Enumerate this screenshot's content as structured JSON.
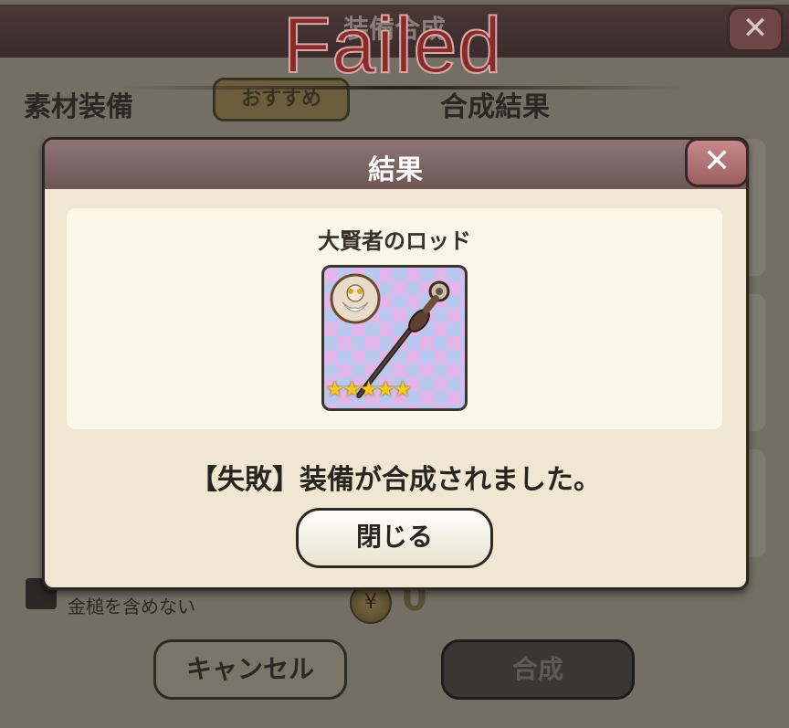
{
  "background": {
    "title": "装備合成",
    "material_label": "素材装備",
    "recommend_button": "おすすめ",
    "result_label": "合成結果",
    "exclude_hammer_label": "金槌を含めない",
    "cost_value": "0",
    "cancel_button": "キャンセル",
    "synthesize_button": "合成",
    "close_icon": "✕"
  },
  "banner": {
    "text": "Failed"
  },
  "modal": {
    "title": "結果",
    "close_icon": "✕",
    "item_name": "大賢者のロッド",
    "item_icon": "wizard-staff-icon",
    "stars": "★★★★★",
    "rarity": 5,
    "message": "【失敗】装備が合成されました。",
    "close_button": "閉じる"
  },
  "colors": {
    "modal_header": "#7e6566",
    "failed_text": "#8a2b2b",
    "star": "#f8c81a"
  }
}
